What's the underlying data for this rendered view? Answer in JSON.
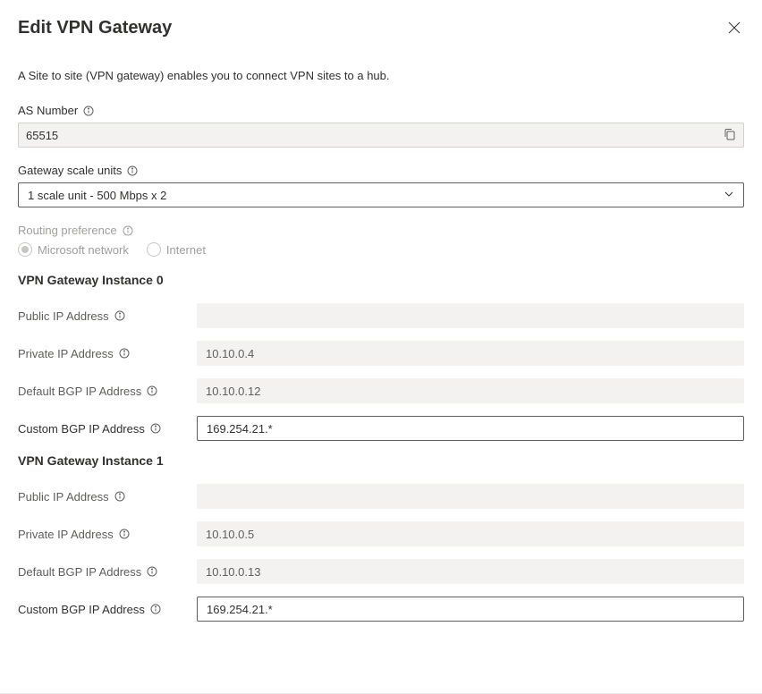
{
  "header": {
    "title": "Edit VPN Gateway"
  },
  "description": "A Site to site (VPN gateway) enables you to connect VPN sites to a hub.",
  "fields": {
    "as_number": {
      "label": "AS Number",
      "value": "65515"
    },
    "scale_units": {
      "label": "Gateway scale units",
      "value": "1 scale unit - 500 Mbps x 2"
    },
    "routing_pref": {
      "label": "Routing preference",
      "option1": "Microsoft network",
      "option2": "Internet"
    }
  },
  "instances": [
    {
      "heading": "VPN Gateway Instance 0",
      "public_ip_label": "Public IP Address",
      "public_ip_value": "",
      "private_ip_label": "Private IP Address",
      "private_ip_value": "10.10.0.4",
      "default_bgp_label": "Default BGP IP Address",
      "default_bgp_value": "10.10.0.12",
      "custom_bgp_label": "Custom BGP IP Address",
      "custom_bgp_value": "169.254.21.*"
    },
    {
      "heading": "VPN Gateway Instance 1",
      "public_ip_label": "Public IP Address",
      "public_ip_value": "",
      "private_ip_label": "Private IP Address",
      "private_ip_value": "10.10.0.5",
      "default_bgp_label": "Default BGP IP Address",
      "default_bgp_value": "10.10.0.13",
      "custom_bgp_label": "Custom BGP IP Address",
      "custom_bgp_value": "169.254.21.*"
    }
  ]
}
